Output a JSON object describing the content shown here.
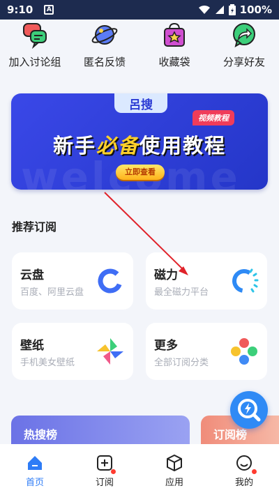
{
  "status_bar": {
    "time": "9:10",
    "badge": "A",
    "battery": "100%"
  },
  "quick_actions": [
    {
      "label": "加入讨论组",
      "icon": "chat-bubbles-icon"
    },
    {
      "label": "匿名反馈",
      "icon": "planet-icon"
    },
    {
      "label": "收藏袋",
      "icon": "shopping-bag-star-icon"
    },
    {
      "label": "分享好友",
      "icon": "share-arrow-icon"
    }
  ],
  "banner": {
    "logo": "呂搜",
    "tag": "视频教程",
    "headline_pre": "新手",
    "headline_highlight": "必备",
    "headline_post": "使用教程",
    "cta": "立即查看",
    "watermark": "welcome"
  },
  "section": {
    "title": "推荐订阅"
  },
  "cards": [
    {
      "title": "云盘",
      "subtitle": "百度、阿里云盘",
      "icon": "cloud-ring-icon"
    },
    {
      "title": "磁力",
      "subtitle": "最全磁力平台",
      "icon": "magnet-spinner-icon"
    },
    {
      "title": "壁纸",
      "subtitle": "手机美女壁纸",
      "icon": "pinwheel-icon"
    },
    {
      "title": "更多",
      "subtitle": "全部订阅分类",
      "icon": "colored-dots-icon"
    }
  ],
  "panels": {
    "hot": "热搜榜",
    "subscribe": "订阅榜"
  },
  "fab": {
    "icon": "search-lightning-icon"
  },
  "bottom_nav": [
    {
      "label": "首页",
      "icon": "home-icon",
      "active": true,
      "badge": false
    },
    {
      "label": "订阅",
      "icon": "subscribe-plus-icon",
      "active": false,
      "badge": true
    },
    {
      "label": "应用",
      "icon": "cube-icon",
      "active": false,
      "badge": false
    },
    {
      "label": "我的",
      "icon": "smiley-icon",
      "active": false,
      "badge": true
    }
  ],
  "colors": {
    "accent": "#2e7cf6",
    "banner": "#3a48e8",
    "badge": "#ff3b30",
    "annotation": "#e0222a"
  }
}
